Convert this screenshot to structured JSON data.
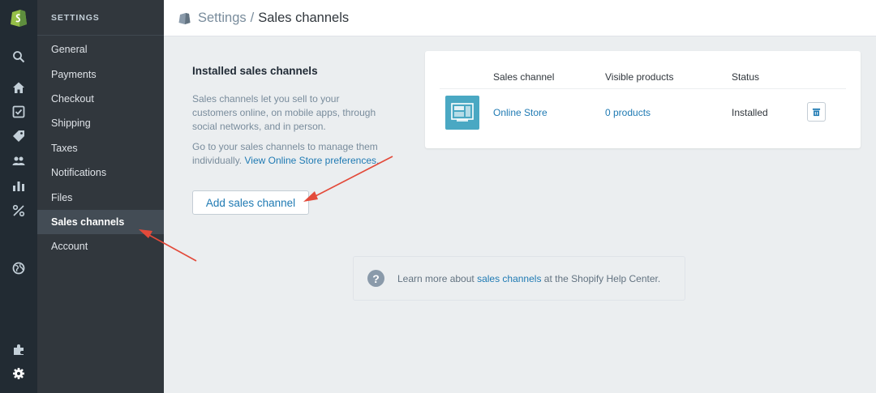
{
  "sidebar": {
    "heading": "SETTINGS",
    "items": [
      {
        "label": "General"
      },
      {
        "label": "Payments"
      },
      {
        "label": "Checkout"
      },
      {
        "label": "Shipping"
      },
      {
        "label": "Taxes"
      },
      {
        "label": "Notifications"
      },
      {
        "label": "Files"
      },
      {
        "label": "Sales channels",
        "active": true
      },
      {
        "label": "Account"
      }
    ]
  },
  "header": {
    "breadcrumb": "Settings",
    "separator": "/",
    "title": "Sales channels"
  },
  "installed": {
    "heading": "Installed sales channels",
    "paragraph1": "Sales channels let you sell to your customers online, on mobile apps, through social networks, and in person.",
    "paragraph2_text": "Go to your sales channels to manage them individually. ",
    "paragraph2_link": "View Online Store preferences.",
    "add_button": "Add sales channel"
  },
  "table": {
    "columns": [
      "Sales channel",
      "Visible products",
      "Status"
    ],
    "rows": [
      {
        "channel": "Online Store",
        "products": "0 products",
        "status": "Installed"
      }
    ]
  },
  "help": {
    "text_before": "Learn more about ",
    "link": "sales channels",
    "text_after": " at the Shopify Help Center.",
    "icon": "?"
  },
  "colors": {
    "accent": "#1f7ab3",
    "annotation_arrow": "#e34a3a",
    "sidebar_bg": "#31373d",
    "rail_bg": "#222b33",
    "logo_green": "#96bf48"
  }
}
